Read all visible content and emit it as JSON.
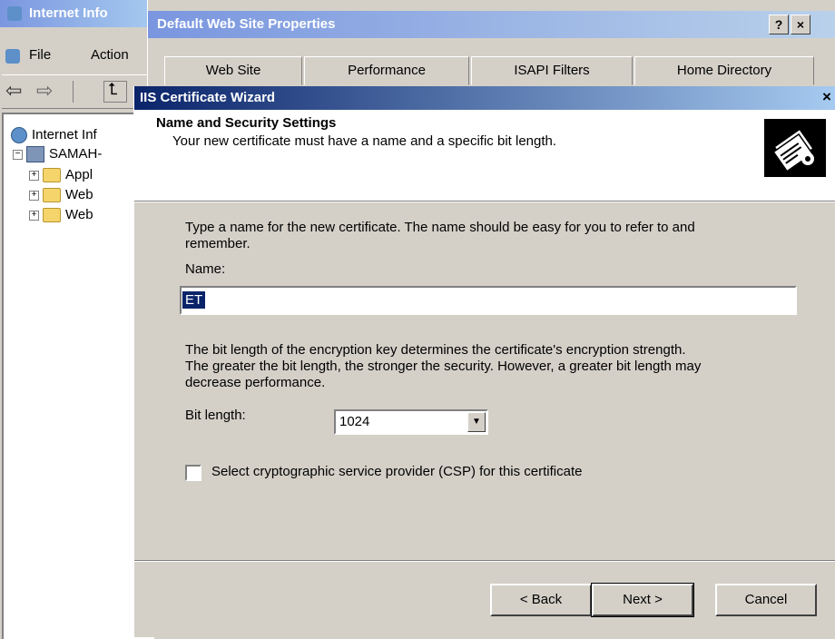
{
  "iis_window": {
    "title": "Internet Info",
    "menu": {
      "file_label": "File",
      "action_label": "Action"
    },
    "tree": [
      {
        "label": "Internet Inf"
      },
      {
        "label": "SAMAH-"
      },
      {
        "label": "Appl"
      },
      {
        "label": "Web"
      },
      {
        "label": "Web"
      }
    ]
  },
  "properties_window": {
    "title": "Default Web Site Properties",
    "help_button": "?",
    "close_button": "×",
    "tabs": [
      {
        "label": "Web Site"
      },
      {
        "label": "Performance"
      },
      {
        "label": "ISAPI Filters"
      },
      {
        "label": "Home Directory"
      }
    ]
  },
  "wizard": {
    "title": "IIS Certificate Wizard",
    "close_button": "×",
    "header_title": "Name and Security Settings",
    "header_subtitle": "Your new certificate must have a name and a specific bit length.",
    "name_instructions_line1": "Type a name for the new certificate. The name should be easy for you to refer to and",
    "name_instructions_line2": "remember.",
    "name_label": "Name:",
    "name_value": "ET",
    "bit_instructions_line1": "The bit length of the encryption key determines the certificate's encryption strength.",
    "bit_instructions_line2": "The greater the bit length, the stronger the security.  However, a greater bit length may",
    "bit_instructions_line3": "decrease performance.",
    "bit_length_label": "Bit length:",
    "bit_length_value": "1024",
    "csp_checkbox_label": "Select cryptographic service provider (CSP) for this certificate",
    "csp_checked": false,
    "back_button": "< Back",
    "next_button": "Next >",
    "cancel_button": "Cancel"
  },
  "colors": {
    "wizard_titlebar": "#0a246a",
    "window_face": "#d4d0c8",
    "selection": "#0a246a"
  }
}
